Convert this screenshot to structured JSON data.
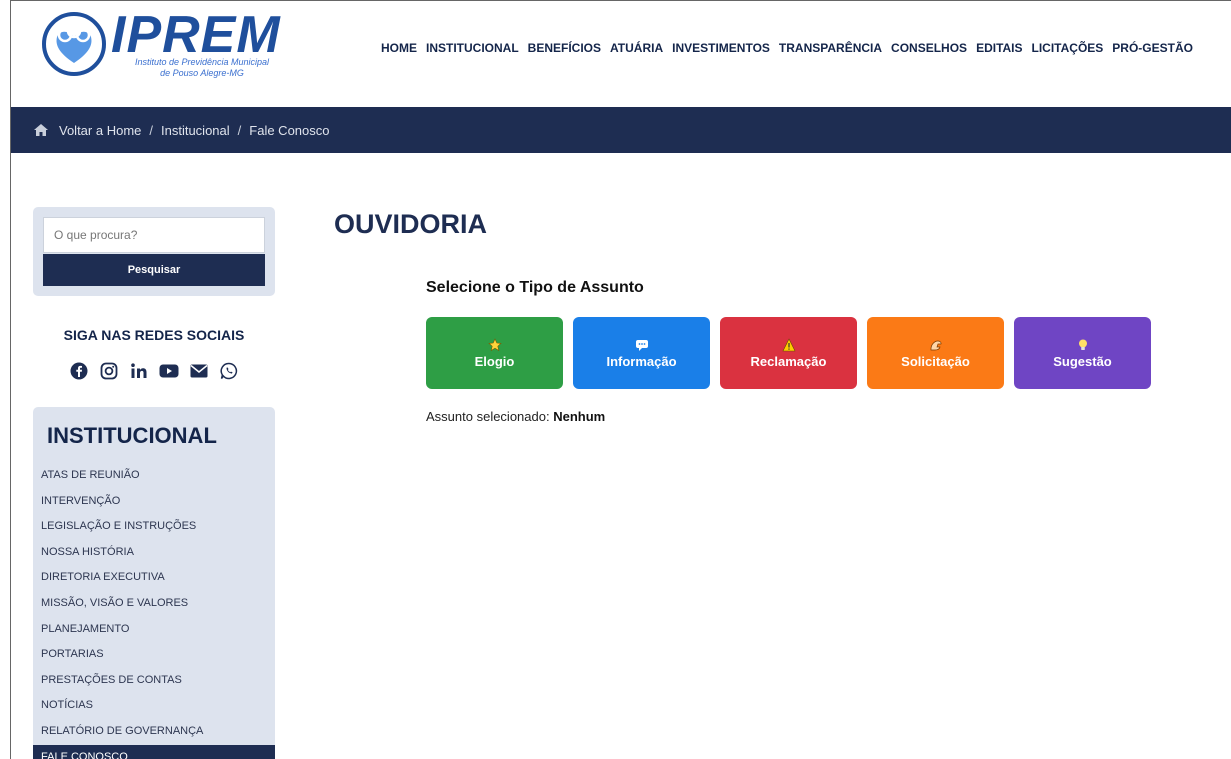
{
  "colors": {
    "navy": "#1e2d52",
    "elogio": "#2e9e45",
    "informacao": "#1a7fe8",
    "reclamacao": "#da3240",
    "solicitacao": "#fb7a16",
    "sugestao": "#6f45c4",
    "brand_blue": "#1f4f9c"
  },
  "logo": {
    "word": "IPREM",
    "subtitle_line1": "Instituto de Previdência Municipal",
    "subtitle_line2": "de Pouso Alegre-MG"
  },
  "nav": [
    "HOME",
    "INSTITUCIONAL",
    "BENEFÍCIOS",
    "ATUÁRIA",
    "INVESTIMENTOS",
    "TRANSPARÊNCIA",
    "CONSELHOS",
    "EDITAIS",
    "LICITAÇÕES",
    "PRÓ-GESTÃO"
  ],
  "breadcrumb": {
    "icon": "home-icon",
    "home": "Voltar a Home",
    "separator": "/",
    "level1": "Institucional",
    "level2": "Fale Conosco"
  },
  "search": {
    "placeholder": "O que procura?",
    "button_label": "Pesquisar"
  },
  "social": {
    "title": "SIGA NAS REDES SOCIAIS",
    "icons": [
      "facebook-icon",
      "instagram-icon",
      "linkedin-icon",
      "youtube-icon",
      "email-icon",
      "whatsapp-icon"
    ]
  },
  "institucional": {
    "title": "INSTITUCIONAL",
    "items": [
      "ATAS DE REUNIÃO",
      "INTERVENÇÃO",
      "LEGISLAÇÃO E INSTRUÇÕES",
      "NOSSA HISTÓRIA",
      "DIRETORIA EXECUTIVA",
      "MISSÃO, VISÃO E VALORES",
      "PLANEJAMENTO",
      "PORTARIAS",
      "PRESTAÇÕES DE CONTAS",
      "NOTÍCIAS",
      "RELATÓRIO DE GOVERNANÇA",
      "FALE CONOSCO"
    ],
    "active": "FALE CONOSCO"
  },
  "main": {
    "title": "OUVIDORIA",
    "subject_prompt": "Selecione o Tipo de Assunto",
    "buttons": [
      {
        "label": "Elogio",
        "icon": "star-icon"
      },
      {
        "label": "Informação",
        "icon": "chat-icon"
      },
      {
        "label": "Reclamação",
        "icon": "warning-icon"
      },
      {
        "label": "Solicitação",
        "icon": "hand-icon"
      },
      {
        "label": "Sugestão",
        "icon": "lightbulb-icon"
      }
    ],
    "selected_prefix": "Assunto selecionado:",
    "selected_value": "Nenhum"
  }
}
